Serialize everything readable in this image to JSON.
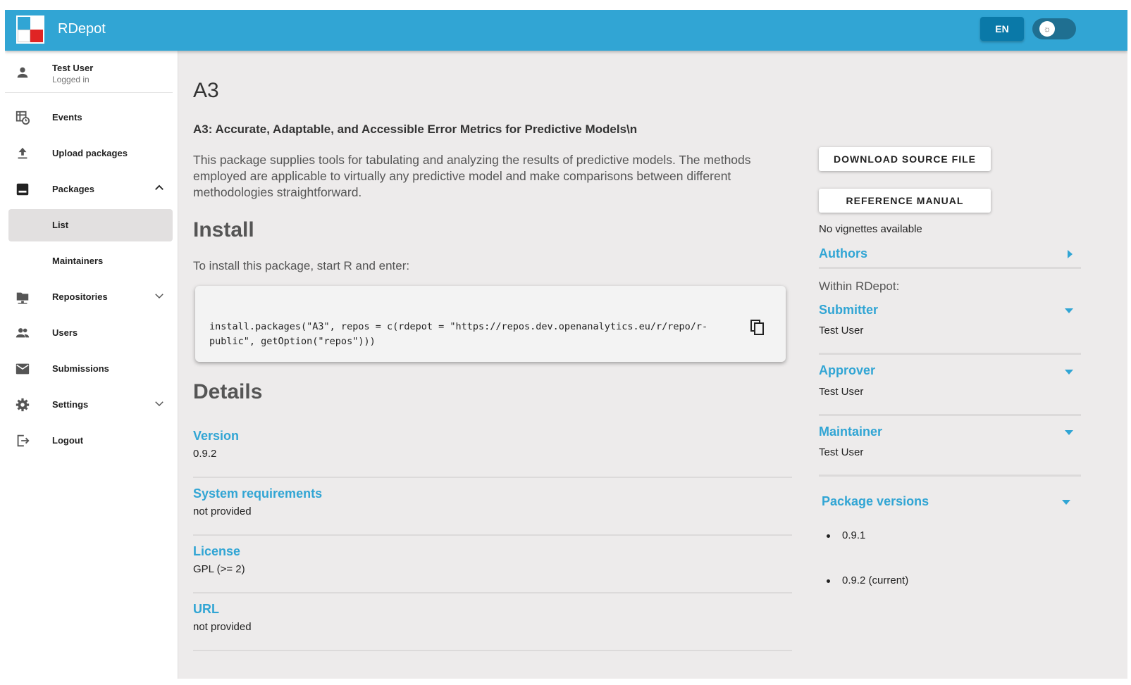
{
  "app": {
    "title": "RDepot"
  },
  "topbar": {
    "language": "EN",
    "theme_icon": "sun-icon"
  },
  "user": {
    "name": "Test User",
    "status": "Logged in"
  },
  "sidebar": {
    "items": [
      {
        "label": "Events",
        "icon": "events-icon"
      },
      {
        "label": "Upload packages",
        "icon": "upload-icon"
      },
      {
        "label": "Packages",
        "icon": "packages-icon",
        "expanded": true
      },
      {
        "label": "List",
        "active": true
      },
      {
        "label": "Maintainers"
      },
      {
        "label": "Repositories",
        "icon": "folder-icon",
        "expanded": false
      },
      {
        "label": "Users",
        "icon": "users-icon"
      },
      {
        "label": "Submissions",
        "icon": "mail-icon"
      },
      {
        "label": "Settings",
        "icon": "gear-icon",
        "expanded": false
      },
      {
        "label": "Logout",
        "icon": "logout-icon"
      }
    ]
  },
  "package": {
    "name": "A3",
    "subtitle": "A3: Accurate, Adaptable, and Accessible Error Metrics for Predictive Models\\n",
    "description": "This package supplies tools for tabulating and analyzing the results of predictive models. The methods employed are applicable to virtually any predictive model and make comparisons between different methodologies straightforward."
  },
  "install": {
    "heading": "Install",
    "intro": "To install this package, start R and enter:",
    "code": "install.packages(\"A3\", repos = c(rdepot = \"https://repos.dev.openanalytics.eu/r/repo/r-public\", getOption(\"repos\")))"
  },
  "details": {
    "heading": "Details",
    "version_label": "Version",
    "version_value": "0.9.2",
    "sysreq_label": "System requirements",
    "sysreq_value": "not provided",
    "license_label": "License",
    "license_value": "GPL (>= 2)",
    "url_label": "URL",
    "url_value": "not provided"
  },
  "side": {
    "download_button": "DOWNLOAD SOURCE FILE",
    "manual_button": "REFERENCE MANUAL",
    "vignettes": "No vignettes available",
    "authors_label": "Authors",
    "within": "Within RDepot:",
    "submitter_label": "Submitter",
    "submitter_value": "Test User",
    "approver_label": "Approver",
    "approver_value": "Test User",
    "maintainer_label": "Maintainer",
    "maintainer_value": "Test User",
    "versions_label": "Package versions",
    "versions": [
      "0.9.1",
      "0.9.2 (current)"
    ]
  },
  "colors": {
    "accent": "#31a5d4",
    "accent_dark": "#0a79a8",
    "logo_red": "#e02424",
    "background": "#edebeb"
  }
}
